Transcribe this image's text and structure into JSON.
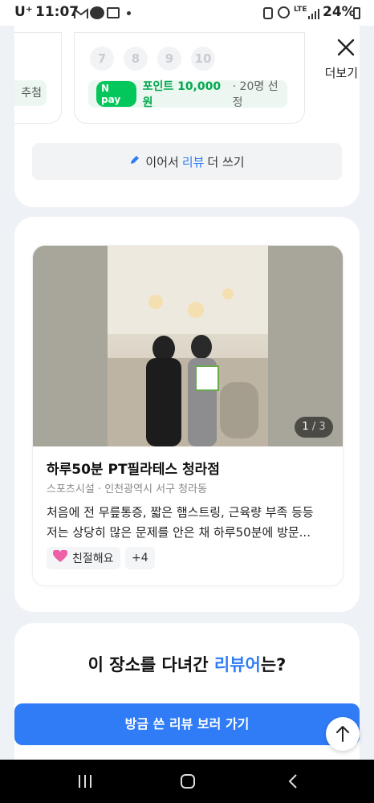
{
  "status_bar": {
    "carrier": "U⁺",
    "time": "11:07",
    "network": "LTE",
    "battery": "24%"
  },
  "header": {
    "more_label": "더보기"
  },
  "event_card": {
    "left_pill_text": "추첨",
    "numbers": [
      "7",
      "8",
      "9",
      "10"
    ],
    "npay_logo": "N pay",
    "npay_point": "포인트 10,000원",
    "npay_count": "· 20명 선정",
    "write_more_prefix": "이어서",
    "write_more_highlight": "리뷰",
    "write_more_suffix": "더 쓰기"
  },
  "review": {
    "photo_page": "1",
    "photo_total": "3",
    "title": "하루50분 PT필라테스 청라점",
    "meta": "스포츠시설 · 인천광역시 서구 청라동",
    "body": "처음에 전 무릎통증, 짧은 햄스트링, 근육량 부족 등등 저는 상당히 많은 문제를 안은 채 하루50분에 방문...",
    "tag_label": "친절해요",
    "tag_more": "+4"
  },
  "reviewers_section": {
    "title_prefix": "이 장소를 다녀간",
    "title_highlight": "리뷰어",
    "title_suffix": "는?"
  },
  "cta": {
    "label": "방금 쓴 리뷰 보러 가기"
  },
  "colors": {
    "accent": "#2f7cf6",
    "npay_green": "#03c75a"
  }
}
